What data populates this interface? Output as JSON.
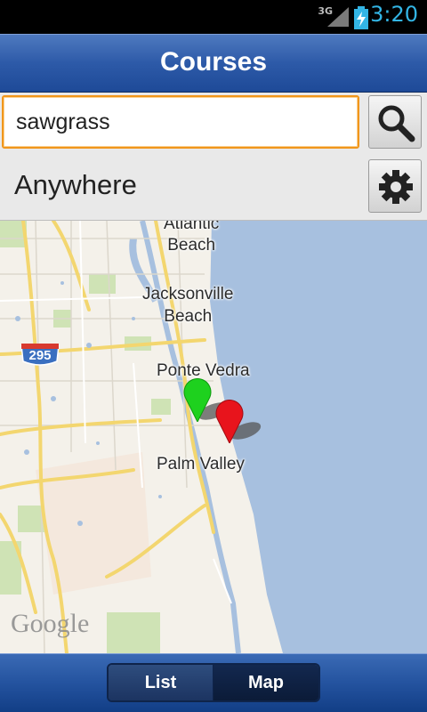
{
  "status_bar": {
    "network": "3G",
    "time": "3:20"
  },
  "header": {
    "title": "Courses"
  },
  "search": {
    "value": "sawgrass"
  },
  "location": {
    "label": "Anywhere"
  },
  "map": {
    "labels": {
      "atlantic_beach": "Atlantic\nBeach",
      "jacksonville_beach": "Jacksonville\nBeach",
      "ponte_vedra": "Ponte Vedra",
      "palm_valley": "Palm Valley",
      "highway_295": "295"
    },
    "provider": "Google",
    "markers": [
      {
        "color": "#1ed11e"
      },
      {
        "color": "#e8141c"
      }
    ]
  },
  "bottom_tabs": {
    "list_label": "List",
    "map_label": "Map",
    "selected": "Map"
  },
  "colors": {
    "accent_orange": "#f0961c",
    "header_blue": "#2d5aa8",
    "status_clock": "#33b5e5"
  }
}
